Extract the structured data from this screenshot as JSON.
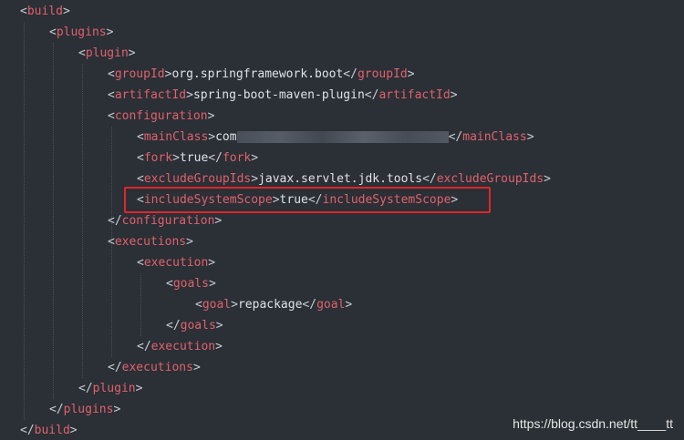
{
  "code": {
    "lines": [
      {
        "indent": 0,
        "open": true,
        "tag": "build"
      },
      {
        "indent": 1,
        "open": true,
        "tag": "plugins"
      },
      {
        "indent": 2,
        "open": true,
        "tag": "plugin"
      },
      {
        "indent": 3,
        "element": "groupId",
        "value": "org.springframework.boot"
      },
      {
        "indent": 3,
        "element": "artifactId",
        "value": "spring-boot-maven-plugin"
      },
      {
        "indent": 3,
        "open": true,
        "tag": "configuration"
      },
      {
        "indent": 4,
        "element": "mainClass",
        "value": "com",
        "redacted": true
      },
      {
        "indent": 4,
        "element": "fork",
        "value": "true"
      },
      {
        "indent": 4,
        "element": "excludeGroupIds",
        "value": "javax.servlet.jdk.tools"
      },
      {
        "indent": 4,
        "element": "includeSystemScope",
        "value": "true",
        "highlighted": true
      },
      {
        "indent": 3,
        "close": true,
        "tag": "configuration"
      },
      {
        "indent": 3,
        "open": true,
        "tag": "executions"
      },
      {
        "indent": 4,
        "open": true,
        "tag": "execution"
      },
      {
        "indent": 5,
        "open": true,
        "tag": "goals"
      },
      {
        "indent": 6,
        "element": "goal",
        "value": "repackage"
      },
      {
        "indent": 5,
        "close": true,
        "tag": "goals"
      },
      {
        "indent": 4,
        "close": true,
        "tag": "execution"
      },
      {
        "indent": 3,
        "close": true,
        "tag": "executions"
      },
      {
        "indent": 2,
        "close": true,
        "tag": "plugin"
      },
      {
        "indent": 1,
        "close": true,
        "tag": "plugins"
      },
      {
        "indent": 0,
        "close": true,
        "tag": "build"
      }
    ]
  },
  "watermark": "https://blog.csdn.net/tt____tt",
  "colors": {
    "background": "#2b2f36",
    "tag": "#e0626b",
    "text": "#dfe3e8",
    "highlight_border": "#e0262b"
  }
}
